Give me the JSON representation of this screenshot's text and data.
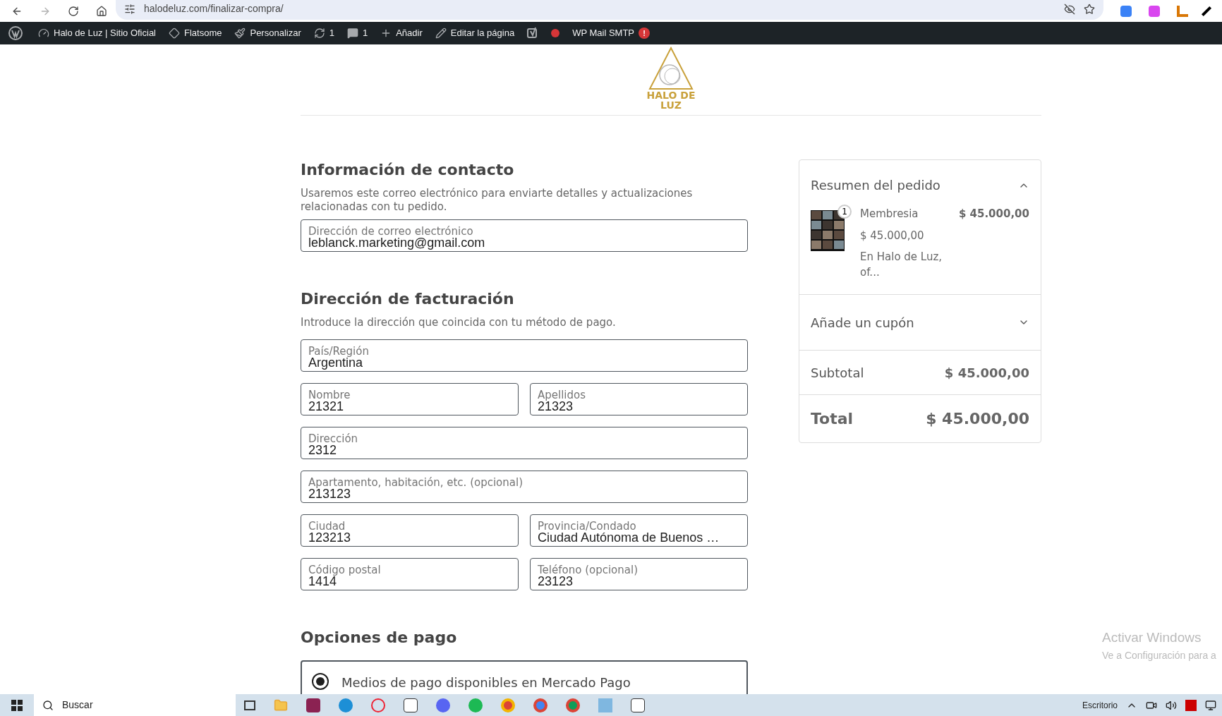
{
  "browser": {
    "url": "halodeluz.com/finalizar-compra/"
  },
  "admin_bar": [
    {
      "kind": "wp"
    },
    {
      "kind": "dashboard",
      "label": "Halo de Luz | Sitio Oficial"
    },
    {
      "kind": "diamond",
      "label": "Flatsome"
    },
    {
      "kind": "brush",
      "label": "Personalizar"
    },
    {
      "kind": "refresh",
      "label": "1"
    },
    {
      "kind": "comment",
      "label": "1"
    },
    {
      "kind": "plus",
      "label": "Añadir"
    },
    {
      "kind": "pencil",
      "label": "Editar la página"
    },
    {
      "kind": "yoast"
    },
    {
      "kind": "dot"
    },
    {
      "kind": "smtp",
      "label": "WP Mail SMTP",
      "badge": "!"
    }
  ],
  "logo": {
    "line1": "HALO DE",
    "line2": "LUZ"
  },
  "contact": {
    "title": "Información de contacto",
    "description": "Usaremos este correo electrónico para enviarte detalles y actualizaciones relacionadas con tu pedido.",
    "email": {
      "label": "Dirección de correo electrónico",
      "value": "leblanck.marketing@gmail.com"
    }
  },
  "billing": {
    "title": "Dirección de facturación",
    "description": "Introduce la dirección que coincida con tu método de pago.",
    "rows": [
      [
        {
          "label": "País/Región",
          "value": "Argentina"
        }
      ],
      [
        {
          "label": "Nombre",
          "value": "21321"
        },
        {
          "label": "Apellidos",
          "value": "21323"
        }
      ],
      [
        {
          "label": "Dirección",
          "value": "2312"
        }
      ],
      [
        {
          "label": "Apartamento, habitación, etc. (opcional)",
          "value": "213123"
        }
      ],
      [
        {
          "label": "Ciudad",
          "value": "123213"
        },
        {
          "label": "Provincia/Condado",
          "value": "Ciudad Autónoma de Buenos …"
        }
      ],
      [
        {
          "label": "Código postal",
          "value": "1414"
        },
        {
          "label": "Teléfono (opcional)",
          "value": "23123"
        }
      ]
    ]
  },
  "payment": {
    "title": "Opciones de pago",
    "options": [
      {
        "label": "Medios de pago disponibles en Mercado Pago",
        "selected": true
      }
    ]
  },
  "summary": {
    "title": "Resumen del pedido",
    "expanded": true,
    "item": {
      "quantity": "1",
      "name": "Membresia",
      "unit_price": "$ 45.000,00",
      "description": "En Halo de Luz, of...",
      "price": "$ 45.000,00"
    },
    "coupon": {
      "label": "Añade un cupón",
      "expanded": false
    },
    "subtotal": {
      "label": "Subtotal",
      "value": "$ 45.000,00"
    },
    "total": {
      "label": "Total",
      "value": "$ 45.000,00"
    }
  },
  "windows_notice": {
    "title": "Activar Windows",
    "text": "Ve a Configuración para a"
  },
  "taskbar": {
    "search": "Buscar",
    "desktop": "Escritorio"
  }
}
